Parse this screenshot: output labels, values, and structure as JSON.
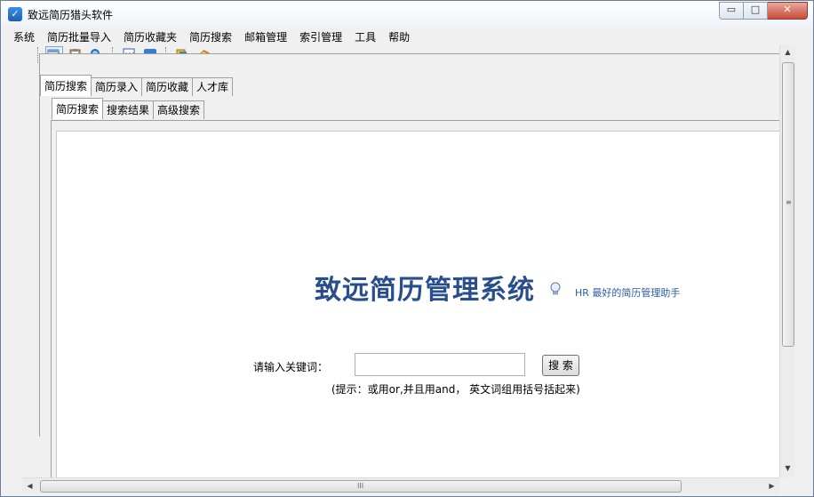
{
  "window": {
    "title": "致远简历猎头软件",
    "controls": {
      "minimize": "▭",
      "maximize": "□",
      "close": "✕"
    }
  },
  "menu": {
    "items": [
      "系统",
      "简历批量导入",
      "简历收藏夹",
      "简历搜索",
      "邮箱管理",
      "索引管理",
      "工具",
      "帮助"
    ]
  },
  "toolbar": {
    "icons": [
      "edit-icon",
      "clipboard-icon",
      "search-icon",
      "word-icon",
      "ie-icon",
      "book-icon",
      "pencil-icon"
    ]
  },
  "tabs_outer": [
    "简历搜索",
    "简历录入",
    "简历收藏",
    "人才库"
  ],
  "tabs_inner": [
    "简历搜索",
    "搜索结果",
    "高级搜索"
  ],
  "main": {
    "brand_title": "致远简历管理系统",
    "tagline": "HR 最好的简历管理助手",
    "keyword_label": "请输入关键词：",
    "keyword_value": "",
    "search_button": "搜 索",
    "hint": "(提示：或用or,并且用and， 英文词组用括号括起来)"
  },
  "scrollbar": {
    "grip": "≡",
    "h_grip": "III",
    "up": "▲",
    "down": "▼",
    "left": "◀",
    "right": "▶"
  },
  "colors": {
    "brand": "#284f8c",
    "tagline": "#2c5aa0",
    "close": "#c74a38"
  }
}
